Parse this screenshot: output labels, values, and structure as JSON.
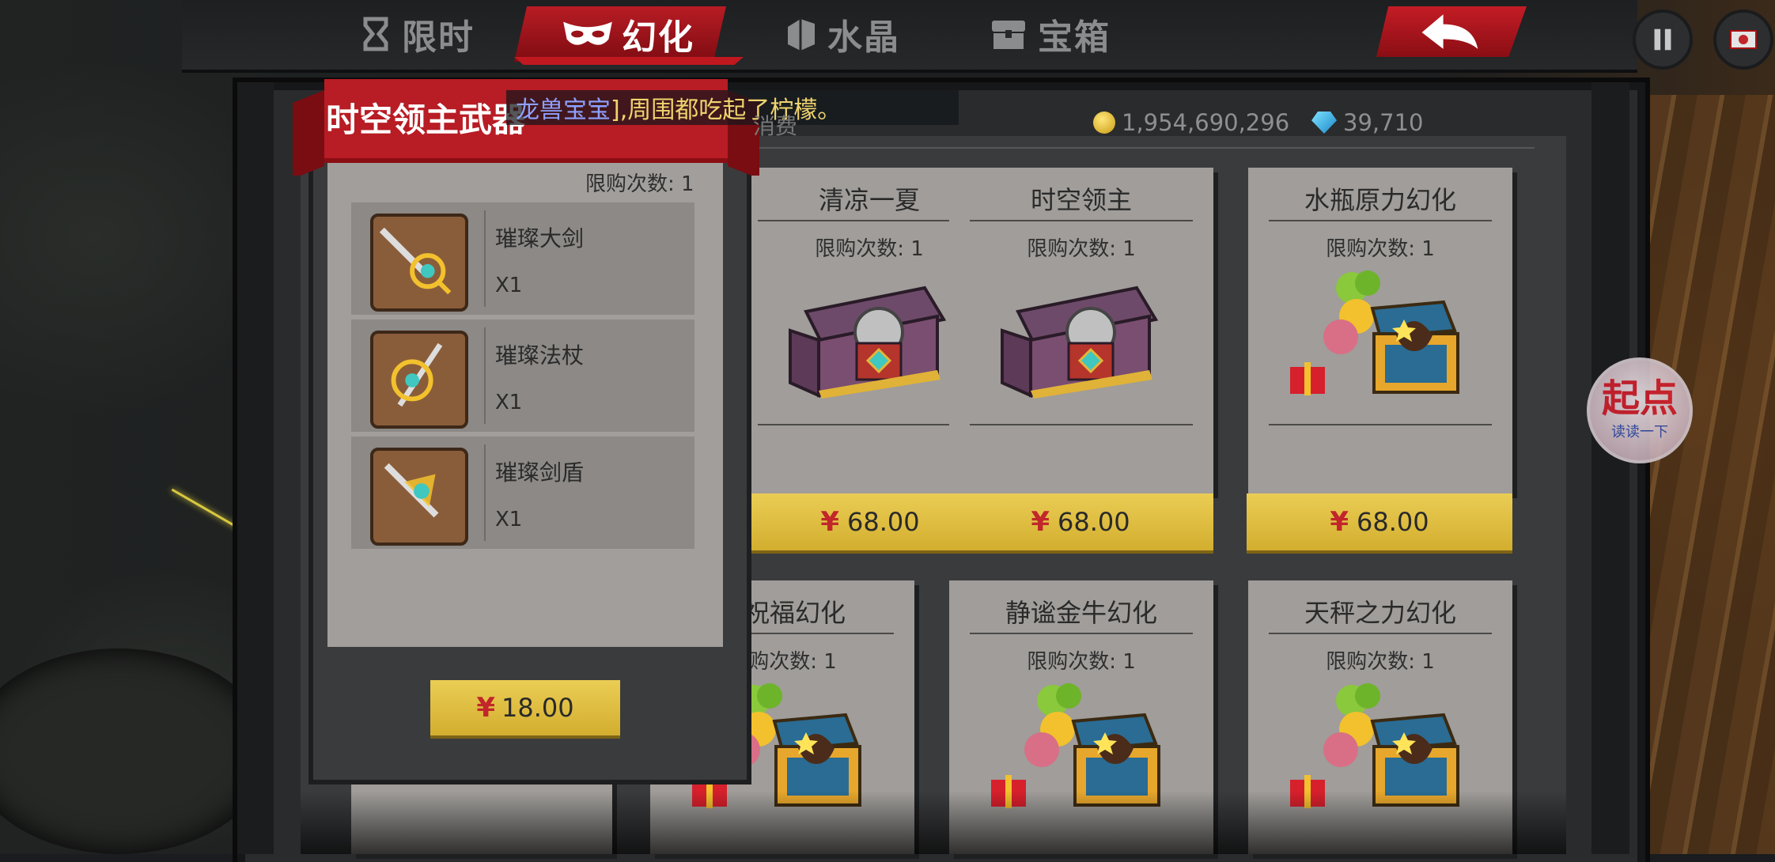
{
  "tabs": [
    {
      "label": "限时",
      "icon": "hourglass-icon"
    },
    {
      "label": "幻化",
      "icon": "mask-icon"
    },
    {
      "label": "水晶",
      "icon": "crystal-icon"
    },
    {
      "label": "宝箱",
      "icon": "chest-icon"
    }
  ],
  "active_tab": "幻化",
  "currency": {
    "gold": "1,954,690,296",
    "gems": "39,710"
  },
  "obscured_subtitle": "消费",
  "cards": [
    {
      "title": "清凉一夏",
      "limit": "限购次数: 1",
      "price": "68.00",
      "image": "purple-treasure-chest"
    },
    {
      "title": "时空领主",
      "limit": "限购次数: 1",
      "price": "68.00",
      "image": "purple-treasure-chest"
    },
    {
      "title": "水瓶原力幻化",
      "limit": "限购次数: 1",
      "price": "68.00",
      "image": "blue-gold-chest-balloons"
    },
    {
      "title": "羊祝福幻化",
      "limit": "限购次数: 1",
      "price": "",
      "image": "blue-gold-chest-balloons"
    },
    {
      "title": "静谧金牛幻化",
      "limit": "限购次数: 1",
      "price": "",
      "image": "blue-gold-chest-balloons"
    },
    {
      "title": "天秤之力幻化",
      "limit": "限购次数: 1",
      "price": "",
      "image": "blue-gold-chest-balloons"
    }
  ],
  "popup": {
    "title": "时空领主武器",
    "limit": "限购次数: 1",
    "items": [
      {
        "name": "璀璨大剑",
        "qty": "X1",
        "icon": "sword-icon"
      },
      {
        "name": "璀璨法杖",
        "qty": "X1",
        "icon": "staff-icon"
      },
      {
        "name": "璀璨剑盾",
        "qty": "X1",
        "icon": "sword-shield-icon"
      }
    ],
    "price": "18.00"
  },
  "marquee": {
    "name": "龙兽宝宝",
    "text": "],周围都吃起了柠檬。"
  },
  "currency_symbol": "¥",
  "badge": {
    "main": "起点",
    "sub": "读读一下"
  },
  "colors": {
    "accent_red": "#b81c24",
    "price_gold": "#e3c244",
    "yen_red": "#c1262b",
    "card_paper": "#a09d9a"
  }
}
